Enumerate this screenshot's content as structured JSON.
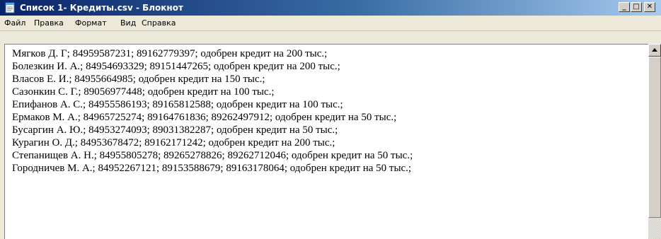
{
  "window": {
    "title": "Список 1- Кредиты.csv - Блокнот",
    "controls": {
      "minimize": "_",
      "maximize": "□",
      "close": "✕"
    },
    "icon": "notepad-icon"
  },
  "menu": {
    "file": "Файл",
    "edit": "Правка",
    "format": "Формат",
    "view": "Вид",
    "help": "Справка"
  },
  "document": {
    "lines": [
      "Мягков Д. Г; 84959587231; 89162779397; одобрен кредит на 200 тыс.;",
      "Болезкин И. А.; 84954693329; 89151447265; одобрен кредит на 200 тыс.;",
      "Власов Е. И.; 84955664985; одобрен кредит на 150 тыс.;",
      "Сазонкин С. Г.; 89056977448; одобрен кредит на 100 тыс.;",
      "Епифанов А. С.; 84955586193; 89165812588; одобрен кредит на 100 тыс.;",
      "Ермаков М. А.; 84965725274; 89164761836; 89262497912; одобрен кредит на 50 тыс.;",
      "Бусаргин А. Ю.; 84953274093; 89031382287; одобрен кредит на 50 тыс.;",
      "Курагин О. Д.; 84953678472; 89162171242; одобрен кредит на 200 тыс.;",
      "Степанищев А. Н.; 84955805278; 89265278826; 89262712046; одобрен кредит на 50 тыс.;",
      "Городничев М. А.; 84952267121; 89153588679; 89163178064; одобрен кредит на 50 тыс.;"
    ]
  },
  "colors": {
    "titlebar_start": "#0a246a",
    "titlebar_end": "#a6caf0",
    "window_face": "#ece9d8"
  }
}
